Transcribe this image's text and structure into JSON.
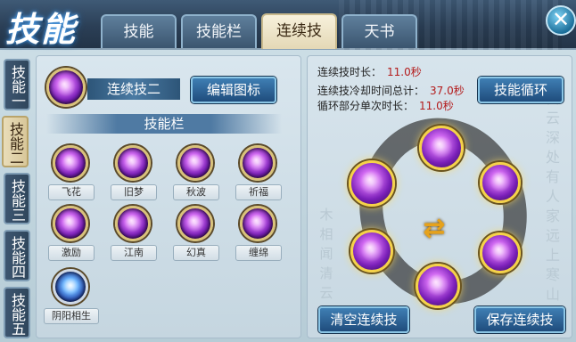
{
  "window": {
    "title": "技能"
  },
  "tabs": [
    {
      "label": "技能"
    },
    {
      "label": "技能栏"
    },
    {
      "label": "连续技"
    },
    {
      "label": "天书"
    }
  ],
  "side_tabs": [
    {
      "label": "技能一"
    },
    {
      "label": "技能二"
    },
    {
      "label": "技能三"
    },
    {
      "label": "技能四"
    },
    {
      "label": "技能五"
    }
  ],
  "combo": {
    "name": "连续技二",
    "edit_icon_label": "编辑图标"
  },
  "skill_bar": {
    "header": "技能栏",
    "skills": [
      {
        "name": "飞花",
        "icon": "petal-skill-icon"
      },
      {
        "name": "旧梦",
        "icon": "light-pillar-icon"
      },
      {
        "name": "秋波",
        "icon": "wave-skill-icon"
      },
      {
        "name": "祈福",
        "icon": "lotus-icon"
      },
      {
        "name": "激励",
        "icon": "bloom-icon"
      },
      {
        "name": "江南",
        "icon": "stream-icon"
      },
      {
        "name": "幻真",
        "icon": "crystal-icon"
      },
      {
        "name": "缠绵",
        "icon": "thread-icon"
      },
      {
        "name": "阴阳相生",
        "icon": "yinyang-ring-icon"
      }
    ]
  },
  "info": {
    "duration_label": "连续技时长：",
    "duration_value": "11.0秒",
    "cooldown_label": "连续技冷却时间总计：",
    "cooldown_value": "37.0秒",
    "loop_label": "循环部分单次时长：",
    "loop_value": "11.0秒"
  },
  "buttons": {
    "cycle": "技能循环",
    "clear": "清空连续技",
    "save": "保存连续技"
  },
  "colors": {
    "accent_gold": "#d9c27a",
    "skill_purple": "#7a1fb8",
    "button_blue": "#1f4c7c",
    "value_red": "#b31b1b"
  }
}
